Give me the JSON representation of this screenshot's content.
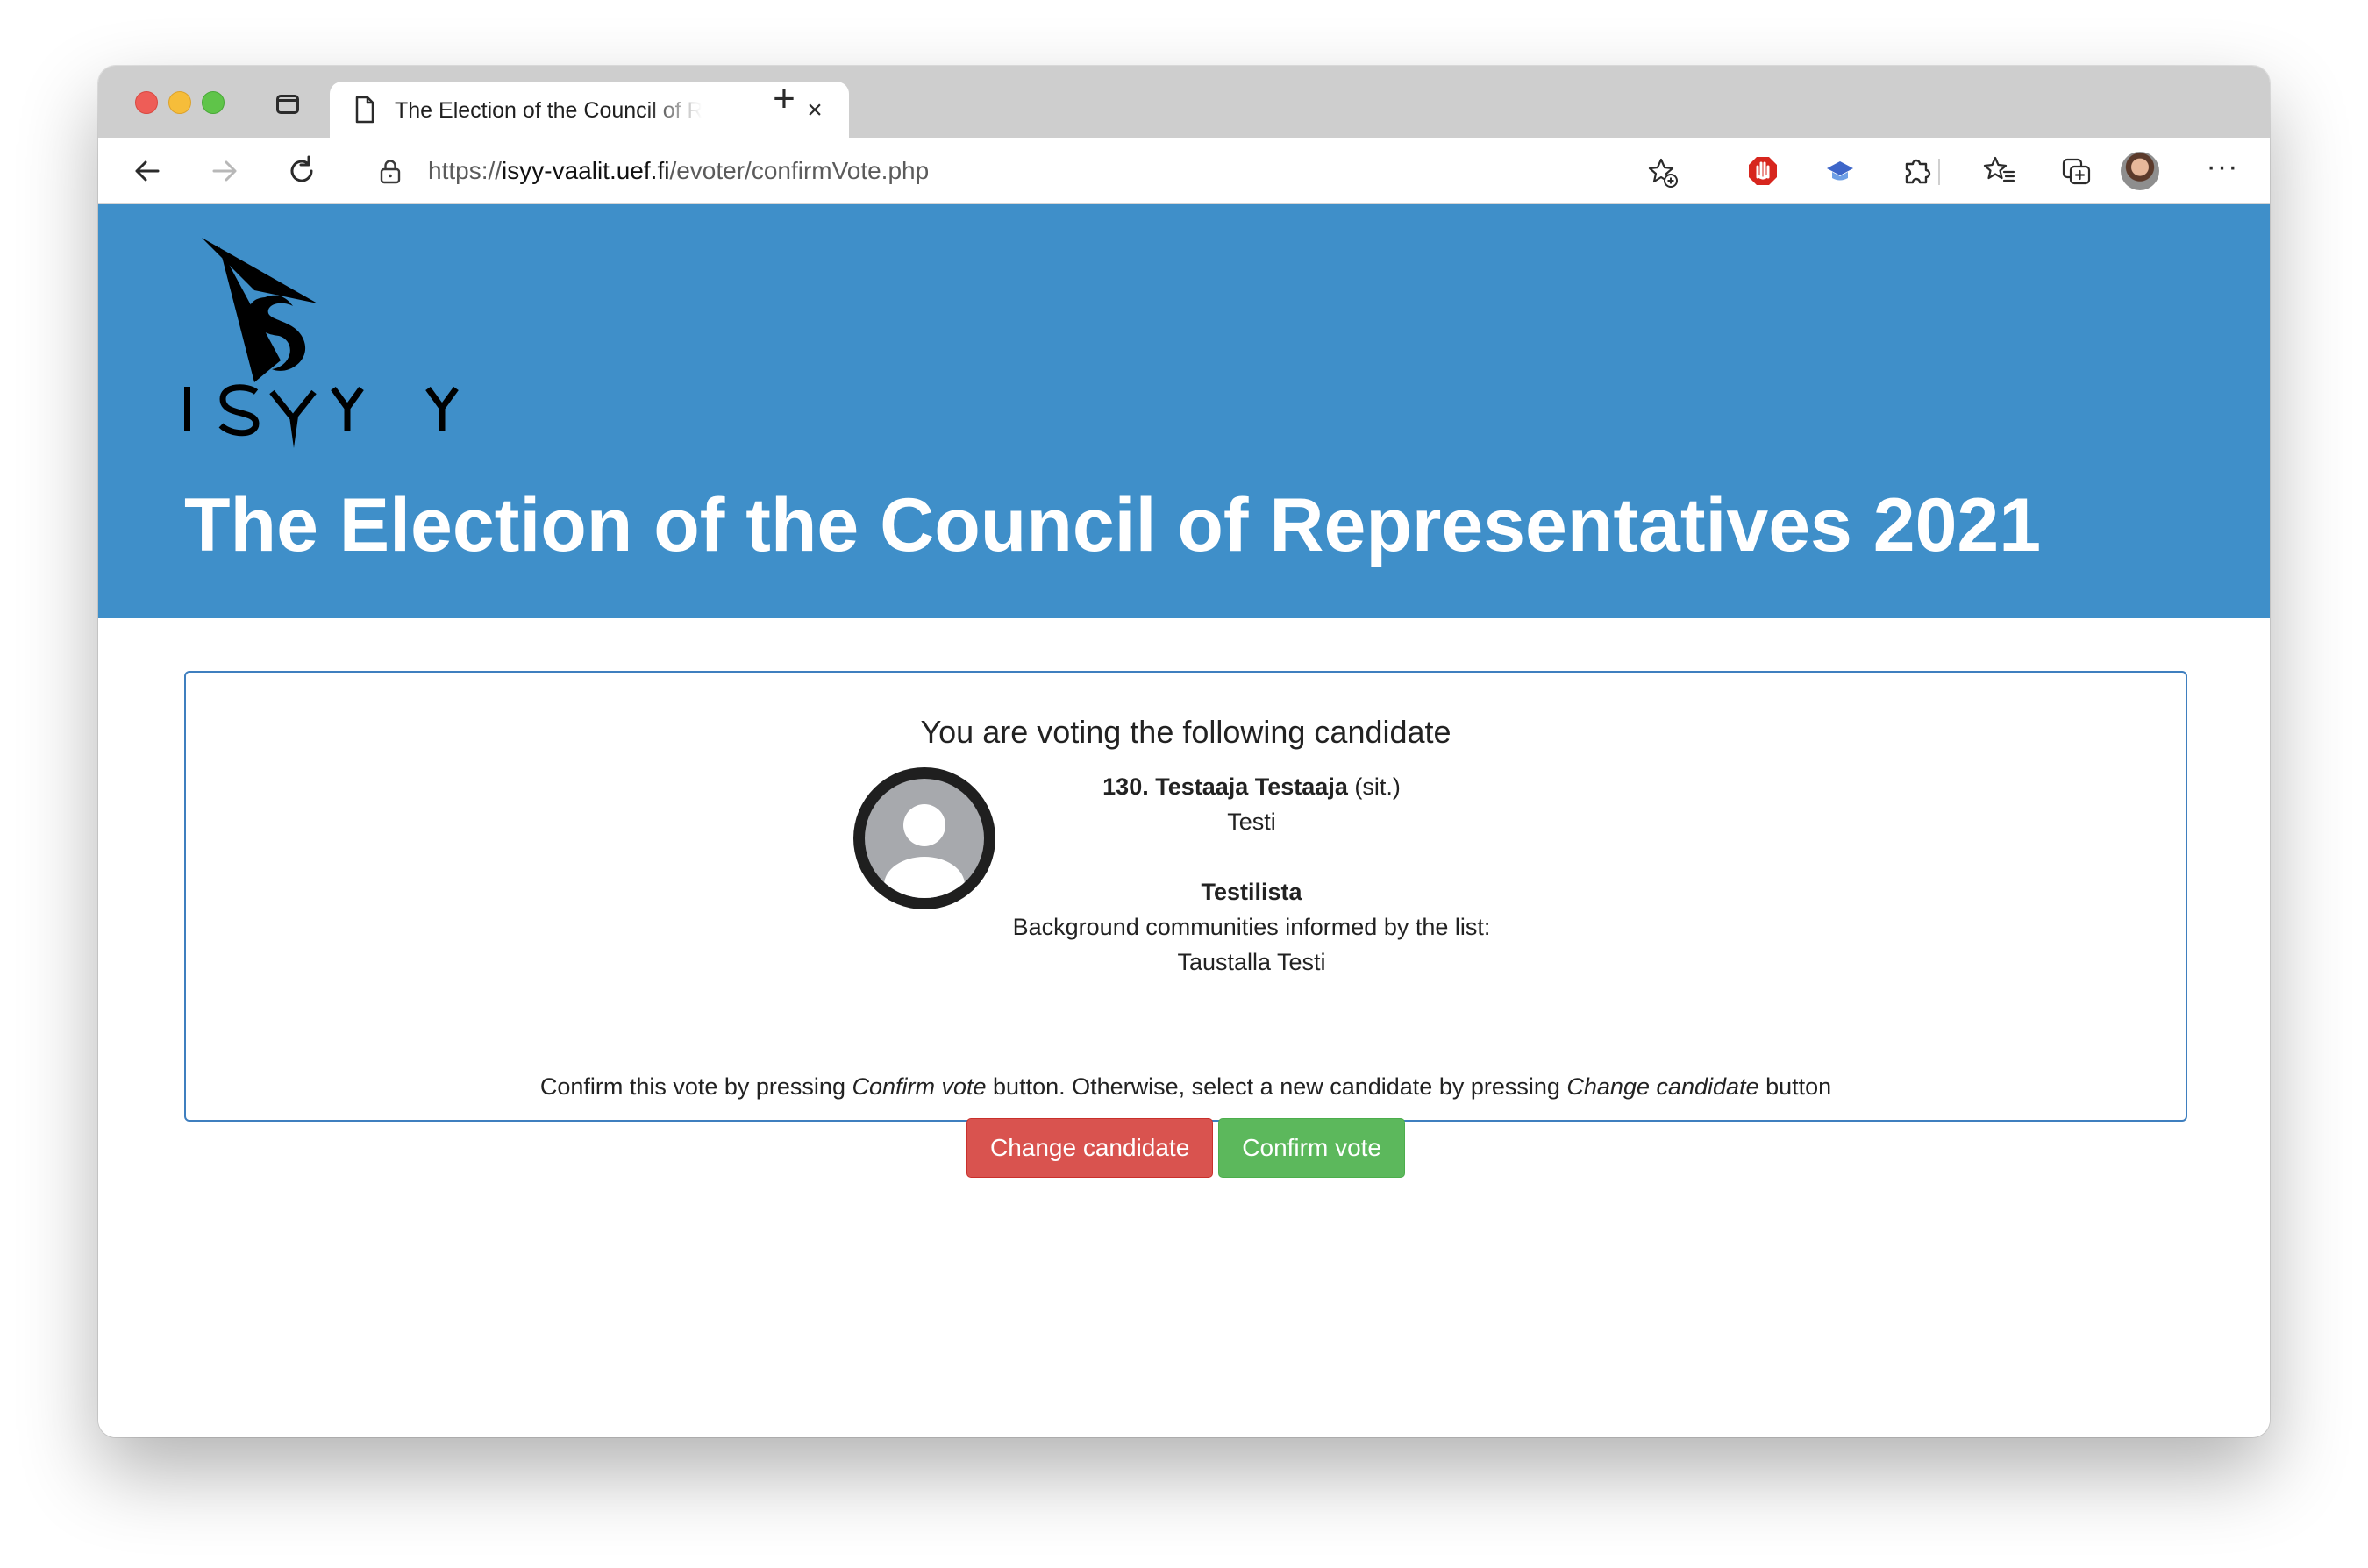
{
  "browser": {
    "tab": {
      "title": "The Election of the Council of Representatives 2021"
    },
    "address": {
      "scheme": "https://",
      "host": "isyy-vaalit.uef.fi",
      "path": "/evoter/confirmVote.php"
    },
    "icons": [
      "sidebar-toggle-icon",
      "page-icon",
      "close-icon",
      "new-tab-icon",
      "back-arrow-icon",
      "forward-arrow-icon",
      "reload-icon",
      "lock-icon",
      "add-favorite-icon",
      "adblock-stop-icon",
      "graduation-cap-icon",
      "extensions-puzzle-icon",
      "favorites-icon",
      "collections-icon",
      "profile-avatar",
      "more-options-icon"
    ]
  },
  "site": {
    "logo_text": "ISYY",
    "title": "The Election of the Council of Representatives 2021",
    "banner_color": "#3f8fc9"
  },
  "vote": {
    "heading": "You are voting the following candidate",
    "candidate": {
      "number_name": "130. Testaaja Testaaja",
      "affiliation": "(sit.)",
      "description": "Testi"
    },
    "list": {
      "name": "Testilista",
      "communities_label": "Background communities informed by the list:",
      "communities": "Taustalla Testi"
    },
    "instruction": {
      "part1": "Confirm this vote by pressing ",
      "confirm_ref": "Confirm vote",
      "part2": " button. Otherwise, select a new candidate by pressing ",
      "change_ref": "Change candidate",
      "part3": " button"
    },
    "buttons": {
      "change": "Change candidate",
      "confirm": "Confirm vote"
    },
    "colors": {
      "change": "#d9534f",
      "confirm": "#5cb85c",
      "panel_border": "#3f7fbf"
    }
  }
}
